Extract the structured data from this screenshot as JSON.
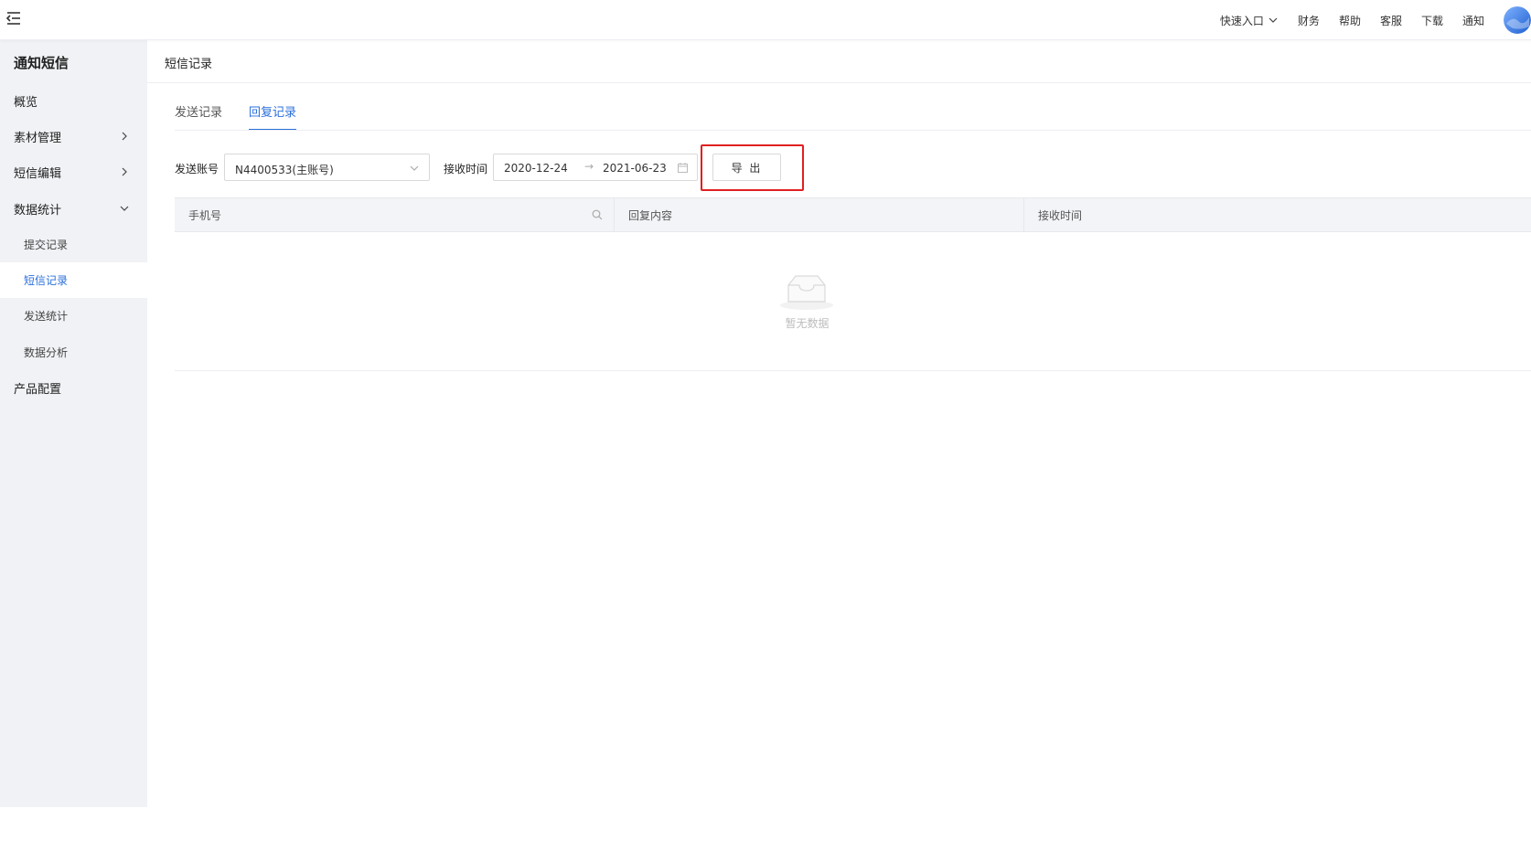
{
  "topbar": {
    "links": [
      "财务",
      "帮助",
      "客服",
      "下载",
      "通知"
    ],
    "quick_entry": "快速入口"
  },
  "sidebar": {
    "title": "通知短信",
    "items": [
      {
        "label": "概览"
      },
      {
        "label": "素材管理"
      },
      {
        "label": "短信编辑"
      },
      {
        "label": "数据统计"
      },
      {
        "label": "产品配置"
      }
    ],
    "sub_items": [
      {
        "label": "提交记录"
      },
      {
        "label": "短信记录",
        "active": true
      },
      {
        "label": "发送统计"
      },
      {
        "label": "数据分析"
      }
    ]
  },
  "main": {
    "breadcrumb": "短信记录",
    "tabs": [
      {
        "label": "发送记录"
      },
      {
        "label": "回复记录",
        "active": true
      }
    ],
    "filters": {
      "account_label": "发送账号",
      "account_value": "N4400533(主账号)",
      "time_label": "接收时间",
      "date_start": "2020-12-24",
      "date_sep": "→",
      "date_end": "2021-06-23",
      "export_label": "导 出"
    },
    "table": {
      "columns": [
        "手机号",
        "回复内容",
        "接收时间"
      ],
      "empty_text": "暂无数据"
    }
  },
  "colors": {
    "accent": "#2a6fdb",
    "highlight": "#e02020"
  }
}
